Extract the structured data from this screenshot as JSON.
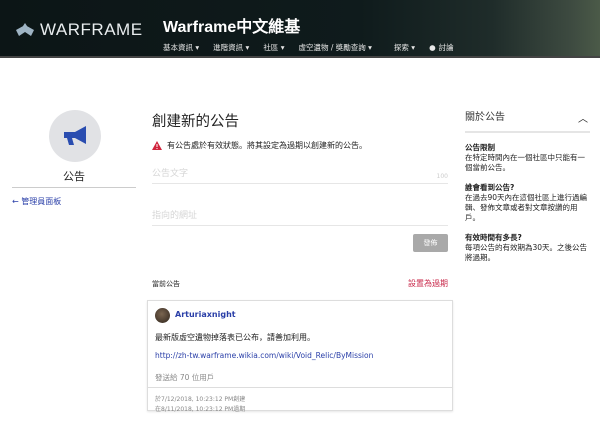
{
  "header": {
    "logo_text": "WARFRAME",
    "site_title": "Warframe中文維基",
    "nav": [
      "基本資訊 ▾",
      "進階資訊 ▾",
      "社區 ▾",
      "虛空遺物 / 獎勵查詢 ▾",
      "探索 ▾",
      "討論"
    ]
  },
  "left": {
    "title": "公告",
    "back_label": "管理員面板"
  },
  "main": {
    "title": "創建新的公告",
    "warning": "有公告處於有效狀態。將其設定為過期以創建新的公告。",
    "text_placeholder": "公告文字",
    "char_limit": "100",
    "url_placeholder": "指向的網址",
    "publish_label": "發佈",
    "current_label": "當前公告",
    "expire_label": "設置為過期",
    "announcement": {
      "user": "Arturiaxnight",
      "message": "最新版虛空遺物掉落表已公布，請善加利用。",
      "link": "http://zh-tw.warframe.wikia.com/wiki/Void_Relic/ByMission",
      "sent": "發送給 70 位用戶",
      "created": "於7/12/2018, 10:23:12 PM創建",
      "expires": "在8/11/2018, 10:23:12 PM過期"
    }
  },
  "about": {
    "title": "關於公告",
    "sections": [
      {
        "heading": "公告限制",
        "body": "在特定時間內在一個社區中只能有一個當前公告。"
      },
      {
        "heading": "誰會看到公告?",
        "body": "在過去90天內在這個社區上進行過編輯、發佈文章或者對文章按讚的用戶。"
      },
      {
        "heading": "有效時間有多長?",
        "body": "每項公告的有效期為30天。之後公告將過期。"
      }
    ]
  }
}
